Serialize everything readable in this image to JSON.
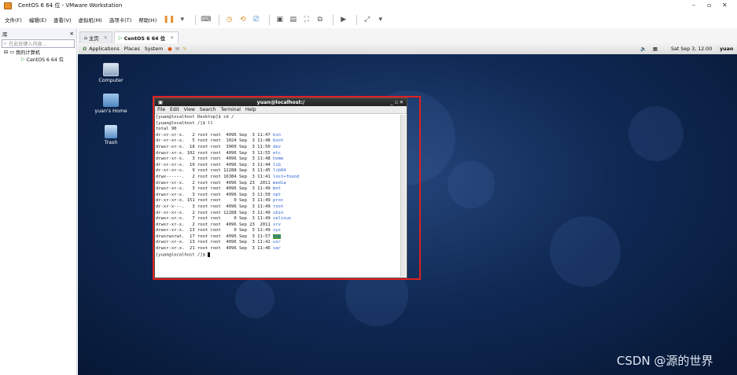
{
  "window": {
    "title": "CentOS 6 64 位 - VMware Workstation",
    "controls": [
      "–",
      "▫",
      "✕"
    ]
  },
  "menubar": {
    "items": [
      "文件(F)",
      "编辑(E)",
      "查看(V)",
      "虚拟机(M)",
      "选项卡(T)",
      "帮助(H)"
    ]
  },
  "library": {
    "title": "库",
    "close": "✕",
    "search_placeholder": "在此处键入内容...",
    "tree": {
      "root": "我的计算机",
      "child": "CentOS 6 64 位"
    }
  },
  "vm_tabs": [
    {
      "label": "主页",
      "close": "✕"
    },
    {
      "label": "CentOS 6 64 位",
      "close": "✕"
    }
  ],
  "guest_panel": {
    "menus": [
      "Applications",
      "Places",
      "System"
    ],
    "clock": "Sat Sep  3, 12:00",
    "user": "yuan"
  },
  "desktop_icons": [
    {
      "label": "Computer"
    },
    {
      "label": "yuan's Home"
    },
    {
      "label": "Trash"
    }
  ],
  "terminal": {
    "title": "yuan@localhost:/",
    "controls": "_ ▫ ✕",
    "menu": [
      "File",
      "Edit",
      "View",
      "Search",
      "Terminal",
      "Help"
    ],
    "lines": [
      {
        "text": "[yuan@localhost Desktop]$ cd /"
      },
      {
        "text": "[yuan@localhost /]$ ll"
      },
      {
        "text": "total 90"
      },
      {
        "text": "dr-xr-xr-x.   2 root root  4096 Sep  3 11:47 ",
        "name": "bin"
      },
      {
        "text": "dr-xr-xr-x.   5 root root  1024 Sep  3 11:48 ",
        "name": "boot"
      },
      {
        "text": "drwxr-xr-x.  18 root root  3900 Sep  3 11:50 ",
        "name": "dev"
      },
      {
        "text": "drwxr-xr-x. 102 root root  4096 Sep  3 11:55 ",
        "name": "etc"
      },
      {
        "text": "drwxr-xr-x.   3 root root  4096 Sep  3 11:48 ",
        "name": "home"
      },
      {
        "text": "dr-xr-xr-x.  10 root root  4096 Sep  3 11:44 ",
        "name": "lib"
      },
      {
        "text": "dr-xr-xr-x.   9 root root 12288 Sep  3 11:45 ",
        "name": "lib64"
      },
      {
        "text": "drwx------.   2 root root 16384 Sep  3 11:41 ",
        "name": "lost+found"
      },
      {
        "text": "drwxr-xr-x.   2 root root  4096 Sep 23  2011 ",
        "name": "media"
      },
      {
        "text": "drwxr-xr-x.   3 root root  4096 Sep  3 11:49 ",
        "name": "mnt"
      },
      {
        "text": "drwxr-xr-x.   3 root root  4096 Sep  3 11:50 ",
        "name": "opt"
      },
      {
        "text": "dr-xr-xr-x. 151 root root     0 Sep  3 11:49 ",
        "name": "proc"
      },
      {
        "text": "dr-xr-x---.   3 root root  4096 Sep  3 11:49 ",
        "name": "root"
      },
      {
        "text": "dr-xr-xr-x.   2 root root 12288 Sep  3 11:49 ",
        "name": "sbin"
      },
      {
        "text": "drwxr-xr-x.   7 root root     0 Sep  3 11:49 ",
        "name": "selinux"
      },
      {
        "text": "drwxr-xr-x.   2 root root  4096 Sep 23  2011 ",
        "name": "srv"
      },
      {
        "text": "drwxr-xr-x.  13 root root     0 Sep  3 11:49 ",
        "name": "sys"
      },
      {
        "text": "drwxrwxrwt.  17 root root  4096 Sep  3 11:57 ",
        "name": "tmp",
        "highlight": true
      },
      {
        "text": "drwxr-xr-x.  13 root root  4096 Sep  3 11:42 ",
        "name": "usr"
      },
      {
        "text": "drwxr-xr-x.  21 root root  4096 Sep  3 11:46 ",
        "name": "var"
      },
      {
        "text": "[yuan@localhost /]$ ",
        "cursor": true
      }
    ]
  },
  "watermark": "CSDN @源的世界",
  "colors": {
    "highlight_box": "#e02020",
    "dir_text": "#2b62d6",
    "desktop_bg": "#102a55"
  }
}
